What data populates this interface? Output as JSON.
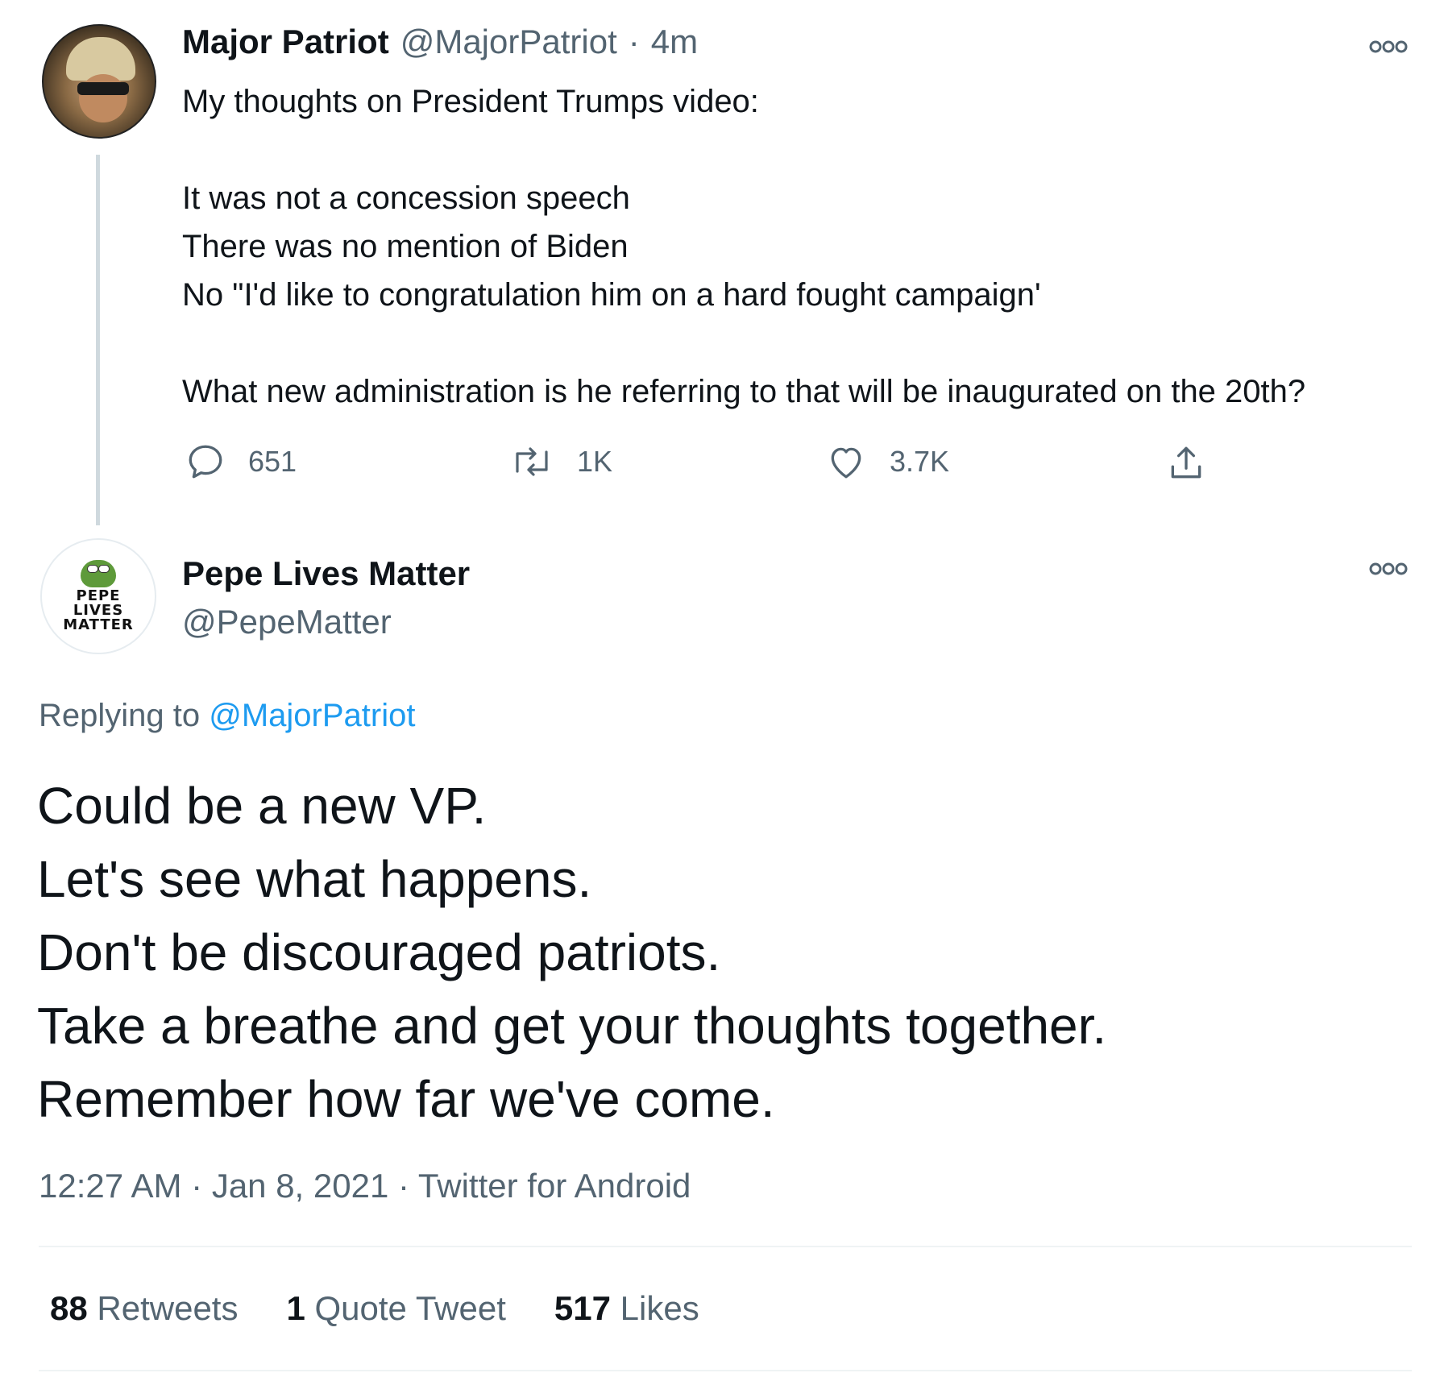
{
  "original_tweet": {
    "display_name": "Major Patriot",
    "handle": "@MajorPatriot",
    "separator": "·",
    "time_ago": "4m",
    "text": "My thoughts on President Trumps video:\n\nIt was not a concession speech\nThere was no mention of Biden\nNo \"I'd like to congratulation him on a hard fought campaign'\n\nWhat new administration is he referring to that will be inaugurated on the 20th?",
    "actions": {
      "replies": "651",
      "retweets": "1K",
      "likes": "3.7K"
    }
  },
  "reply_tweet": {
    "display_name": "Pepe Lives Matter",
    "handle": "@PepeMatter",
    "avatar_text": [
      "PEPE",
      "LIVES",
      "MATTER"
    ],
    "replying_label": "Replying to",
    "replying_mention": "@MajorPatriot",
    "text": "Could be a new VP.\nLet's see what happens.\nDon't be discouraged patriots.\nTake a breathe and get your thoughts together.\nRemember how far we've come.",
    "time": "12:27 AM",
    "date": "Jan 8, 2021",
    "source": "Twitter for Android",
    "separator": "·"
  },
  "stats": {
    "retweets_count": "88",
    "retweets_label": "Retweets",
    "quotes_count": "1",
    "quotes_label": "Quote Tweet",
    "likes_count": "517",
    "likes_label": "Likes"
  },
  "colors": {
    "text": "#0f1419",
    "muted": "#536471",
    "accent": "#1d9bf0",
    "divider": "#eff3f4",
    "thread_line": "#cfd9de"
  },
  "icons": [
    "more-icon",
    "reply-icon",
    "retweet-icon",
    "like-icon",
    "share-icon"
  ]
}
